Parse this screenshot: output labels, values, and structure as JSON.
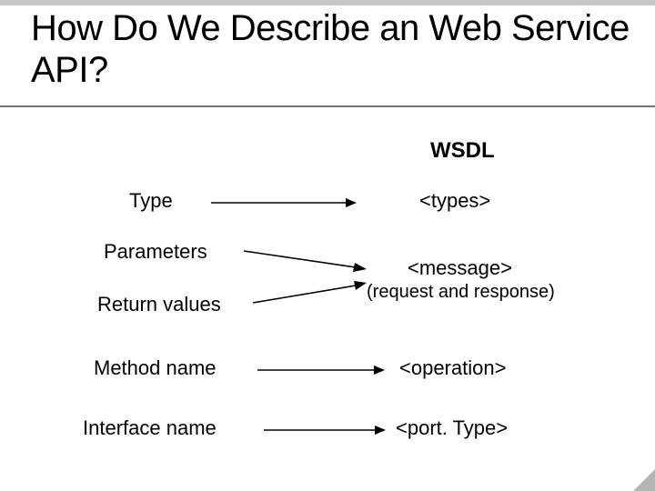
{
  "title": "How Do We Describe an Web Service API?",
  "header_right": "WSDL",
  "left": {
    "type": "Type",
    "parameters": "Parameters",
    "return_values": "Return values",
    "method_name": "Method name",
    "interface_name": "Interface name"
  },
  "right": {
    "types": "<types>",
    "message_line1": "<message>",
    "message_line2": "(request and response)",
    "operation": "<operation>",
    "porttype": "<port. Type>"
  }
}
